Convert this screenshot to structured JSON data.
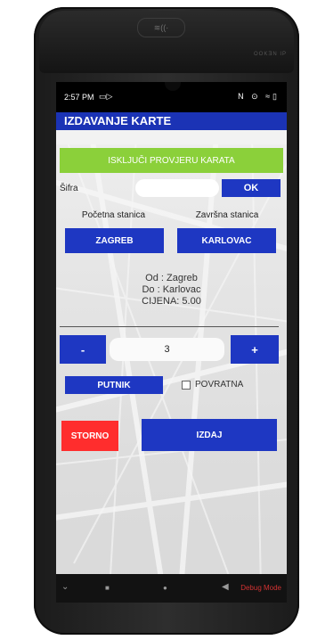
{
  "status_bar": {
    "time": "2:57 PM",
    "cast_glyph": "▭▷",
    "right_glyphs": "N ⊙ ≈▯"
  },
  "device": {
    "nfc_glyph": "≋((·",
    "brand": "OOKƎN IP"
  },
  "app_bar": {
    "title": "IZDAVANJE KARTE"
  },
  "check_button": {
    "label": "ISKLJUČI PROVJERU KARATA"
  },
  "code": {
    "label": "Šifra",
    "value": "",
    "ok_label": "OK"
  },
  "stations": {
    "start_label": "Početna stanica",
    "end_label": "Završna stanica",
    "start_value": "ZAGREB",
    "end_value": "KARLOVAC"
  },
  "summary": {
    "from": "Od : Zagreb",
    "to": "Do : Karlovac",
    "price": "CIJENA: 5.00"
  },
  "quantity": {
    "minus": "-",
    "value": "3",
    "plus": "+"
  },
  "passenger": {
    "button_label": "PUTNIK",
    "return_label": "POVRATNA",
    "return_checked": false
  },
  "actions": {
    "storno": "STORNO",
    "issue": "IZDAJ"
  },
  "nav": {
    "back": "⌄",
    "home": "■",
    "recents": "●",
    "menu": "◀",
    "debug": "Debug Mode"
  },
  "colors": {
    "primary": "#1e37c2",
    "green": "#8bd03a",
    "red": "#ff2d2d",
    "appbar": "#1b33b5"
  }
}
